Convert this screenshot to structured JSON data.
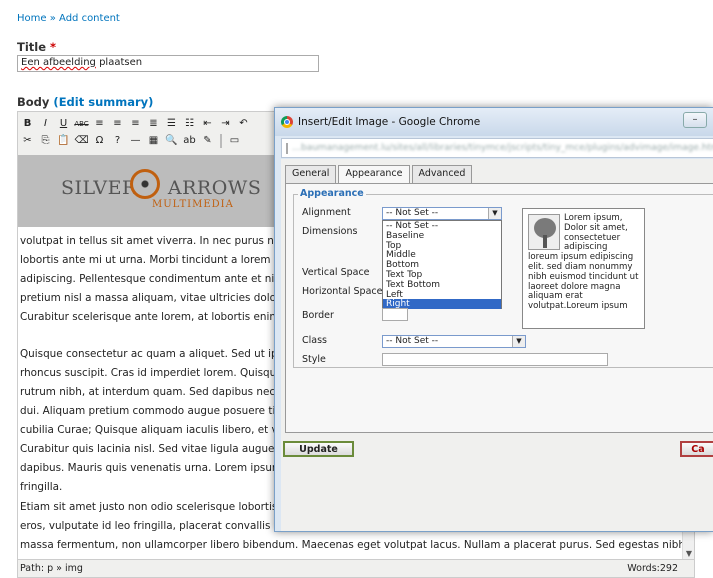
{
  "breadcrumb": {
    "home": "Home",
    "separator": "»",
    "add_content": "Add content"
  },
  "title_field": {
    "label": "Title",
    "required_mark": "*",
    "value_misspelled": "Een afbeelding",
    "value_rest": " plaatsen"
  },
  "body_field": {
    "label": "Body",
    "edit_summary_open": "(",
    "edit_summary_link": "Edit summary",
    "edit_summary_close": ")"
  },
  "editor": {
    "logo": {
      "text_a": "SILVER",
      "text_b": "ARROWS",
      "sub": "MULTIMEDIA"
    },
    "paragraphs": [
      "volutpat in tellus sit amet viverra. In nec purus nisi\nlobortis ante mi ut urna. Morbi tincidunt a lorem\nadipiscing. Pellentesque condimentum ante et nisi\npretium nisl a massa aliquam, vitae ultricies dolor\nCurabitur scelerisque ante lorem, at lobortis enim",
      "Quisque consectetur ac quam a aliquet. Sed ut ipsu\nrhoncus suscipit. Cras id imperdiet lorem. Quisque\nrutrum nibh, at interdum quam. Sed dapibus nec ju\ndui. Aliquam pretium commodo augue posuere tin\ncubilia Curae; Quisque aliquam iaculis libero, et vu",
      "Curabitur quis lacinia nisl. Sed vitae ligula augue.\ndapibus. Mauris quis venenatis urna. Lorem ipsum\nfringilla.",
      "Etiam sit amet justo non odio scelerisque lobortis.\neros, vulputate id leo fringilla, placerat convallis fe\nmassa fermentum, non ullamcorper libero bibendum. Maecenas eget volutpat lacus. Nullam a placerat purus. Sed egestas nibh sed\npellentesque convallis. Praesent dui est, aliquam vel hendrerit congue, placerat vel augue. Aenean enim diam, pulvinar eu mollis"
    ],
    "status_path": "Path: p » img",
    "word_count": "Words:292"
  },
  "dialog": {
    "window_title": "Insert/Edit Image - Google Chrome",
    "url": "…baumanagement.lu/sites/all/libraries/tinymce/jscripts/tiny_mce/plugins/advimage/image.htm",
    "tabs": [
      "General",
      "Appearance",
      "Advanced"
    ],
    "active_tab": "Appearance",
    "legend": "Appearance",
    "labels": {
      "alignment": "Alignment",
      "dimensions": "Dimensions",
      "vertical_space": "Vertical Space",
      "horizontal_space": "Horizontal Space",
      "border": "Border",
      "class": "Class",
      "style": "Style"
    },
    "alignment_value": "-- Not Set --",
    "alignment_options": [
      "-- Not Set --",
      "Baseline",
      "Top",
      "Middle",
      "Bottom",
      "Text Top",
      "Text Bottom",
      "Left",
      "Right"
    ],
    "alignment_highlighted": "Right",
    "class_value": "-- Not Set --",
    "preview_text": "Lorem ipsum, Dolor sit amet, consectetuer adipiscing loreum ipsum edipiscing elit. sed diam nonummy nibh euismod tincidunt ut laoreet dolore magna aliquam erat volutpat.Loreum ipsum",
    "update_label": "Update",
    "cancel_label": "Ca"
  }
}
